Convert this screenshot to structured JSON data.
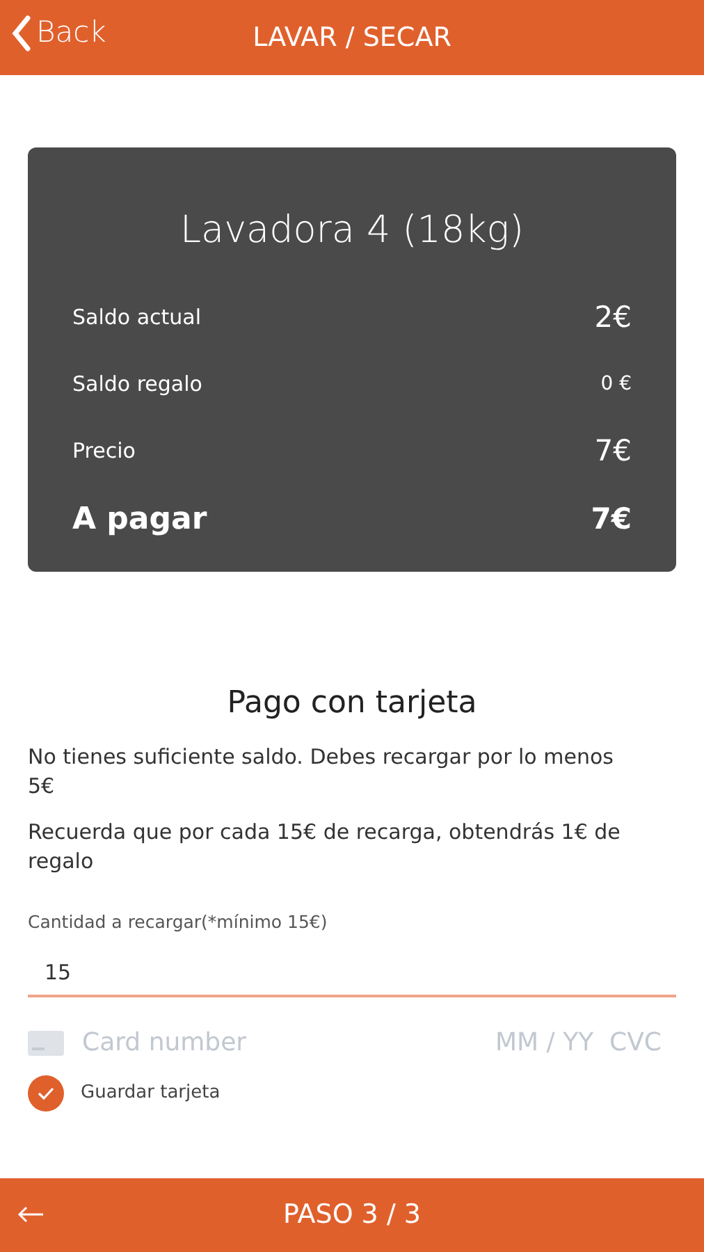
{
  "header": {
    "back_label": "Back",
    "title": "LAVAR / SECAR"
  },
  "summary": {
    "title": "Lavadora 4 (18kg)",
    "rows": [
      {
        "label": "Saldo actual",
        "value": "2€",
        "kind": "normal"
      },
      {
        "label": "Saldo regalo",
        "value": "0 €",
        "kind": "small"
      },
      {
        "label": "Precio",
        "value": "7€",
        "kind": "normal"
      },
      {
        "label": "A pagar",
        "value": "7€",
        "kind": "total"
      }
    ]
  },
  "payment": {
    "title": "Pago con tarjeta",
    "messages": [
      "No tienes suficiente saldo. Debes recargar por lo menos 5€",
      "Recuerda que por cada 15€ de recarga, obtendrás 1€ de regalo"
    ],
    "amount": {
      "label": "Cantidad a recargar(*mínimo 15€)",
      "value": "15"
    },
    "card": {
      "number_placeholder": "Card number",
      "expiry_placeholder": "MM / YY",
      "cvc_placeholder": "CVC"
    },
    "save_card": {
      "label": "Guardar tarjeta",
      "checked": true
    }
  },
  "footer": {
    "step": "PASO 3 / 3"
  }
}
